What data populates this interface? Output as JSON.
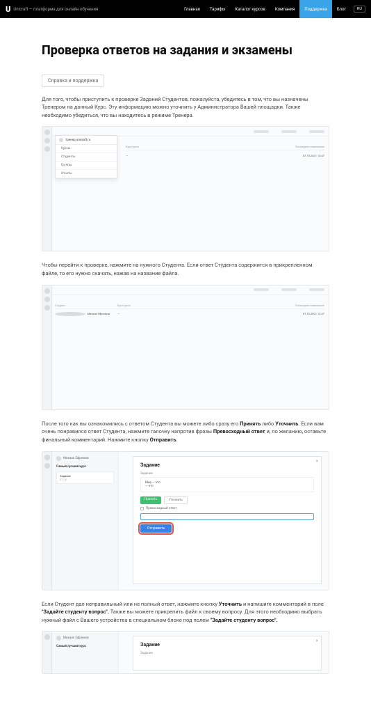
{
  "nav": {
    "logo": "U",
    "tagline": "Unicraft — платформа для онлайн обучения",
    "items": [
      "Главная",
      "Тарифы",
      "Каталог курсов",
      "Компания",
      "Поддержка",
      "Блог"
    ],
    "active": "Поддержка",
    "lang": "RU"
  },
  "page": {
    "title": "Проверка ответов на задания и экзамены",
    "tag": "Справка и поддержка",
    "p1": "Для того, чтобы приступить к проверке Заданий Студентов, пожалуйста, убедитесь в том, что вы назначены Тренером на данный Курс. Эту информацию можно уточнить у Администратора Вашей площадки. Также необходимо убедиться, что вы находитесь в режиме Тренера.",
    "p2": "Чтобы перейти к проверке, нажмите на нужного Студента. Если ответ Студента содержится в прикрепленном файле, то его нужно скачать, нажав на название файла.",
    "p3_a": "После того как вы ознакомились с ответом Студента вы можете либо сразу его ",
    "p3_b1": "Принять",
    "p3_c": " либо ",
    "p3_b2": "Уточнить",
    "p3_d": ". Если вам очень понравился ответ Студента, нажмите галочку напротив фразы ",
    "p3_b3": "Превосходный ответ",
    "p3_e": " и, по желанию, оставьте финальный комментарий. Нажмите кнопку ",
    "p3_b4": "Отправить",
    "p3_f": ".",
    "p4_a": "Если Студент дал неправильный или не полный ответ, нажмите кнопку ",
    "p4_b1": "Уточнить",
    "p4_b": " и напишите комментарий в поле ",
    "p4_b2": "\"Задайте студенту вопрос\".",
    "p4_c": " Также вы можете прикрепить файл к своему вопросу. Для этого необходимо выбрать нужный файл с Вашего устройства в специальном блоке под полем ",
    "p4_b3": "\"Задайте студенту вопрос\"."
  },
  "ss": {
    "dropdown_head": "тренер.unicraft.ru",
    "dd_items": [
      "Курсы",
      "Студенты",
      "Группы",
      "Отчеты"
    ],
    "col_course": "Курс/урок",
    "col_student": "Студент",
    "col_date": "Последнее изменение",
    "row_date": "07.10.2021 13:47",
    "row_course": "—",
    "modal_title": "Задание",
    "modal_label_answer": "Задание",
    "modal_answer_lines": [
      "Мир — это",
      "— что"
    ],
    "btn_accept": "Принять",
    "btn_clarify": "Уточнить",
    "chk_excellent": "Превосходный ответ",
    "btn_send": "Отправить",
    "left_name": "Михаил Ефремов",
    "left_course": "Самый лучший курс",
    "left_task": "Задание",
    "left_date": "07.10"
  }
}
